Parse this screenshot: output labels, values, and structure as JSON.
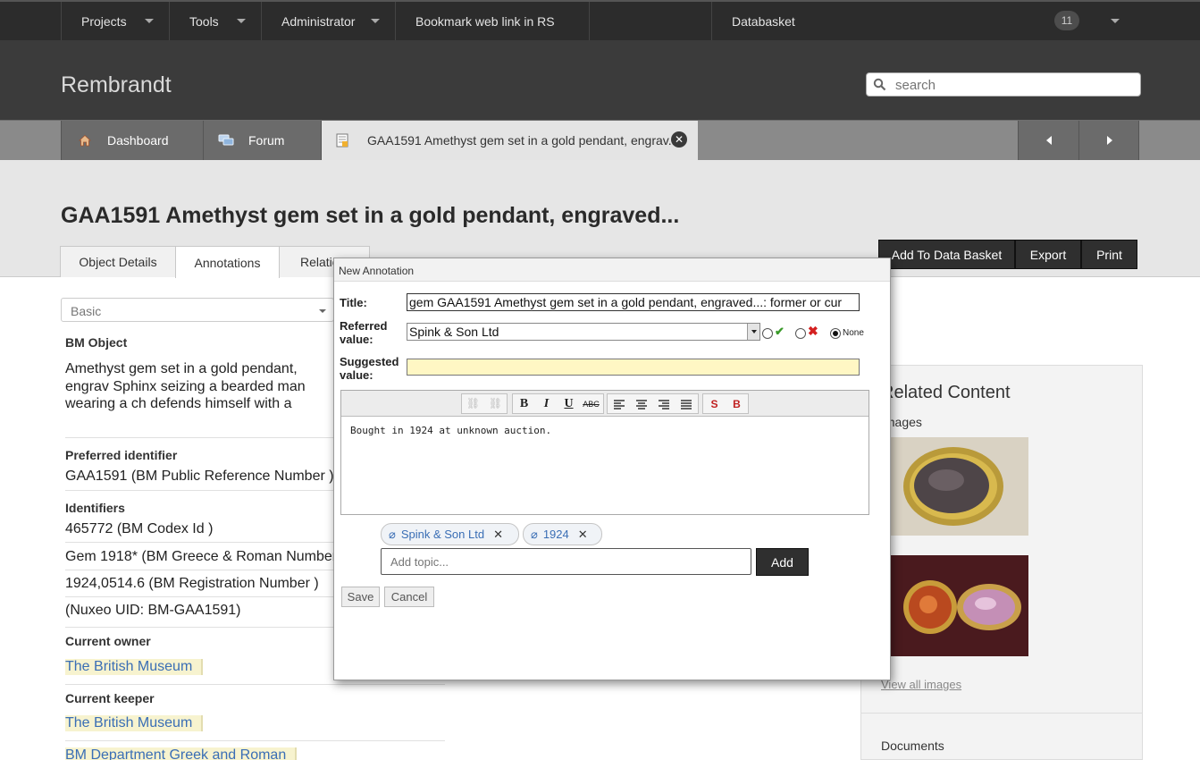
{
  "topnav": {
    "projects": "Projects",
    "tools": "Tools",
    "administrator": "Administrator",
    "bookmark": "Bookmark web link in RS",
    "databasket": "Databasket",
    "badge": "11"
  },
  "header": {
    "site_title": "Rembrandt",
    "search_placeholder": "search"
  },
  "tabs": {
    "dashboard": "Dashboard",
    "forum": "Forum",
    "record": "GAA1591 Amethyst gem set in a gold pendant, engrav..."
  },
  "page": {
    "title": "GAA1591 Amethyst gem set in a gold pendant, engraved...",
    "object_tabs": [
      "Object Details",
      "Annotations",
      "Relatio"
    ],
    "actions": [
      "Add To Data Basket",
      "Export",
      "Print"
    ]
  },
  "object": {
    "view_select": "Basic",
    "bm_object_label": "BM Object",
    "description": "Amethyst gem set in a gold pendant, engrav Sphinx seizing a bearded man wearing a ch defends himself with a sword.",
    "preferred_identifier_label": "Preferred identifier",
    "preferred_identifier": "GAA1591 (BM Public Reference Number )",
    "identifiers_label": "Identifiers",
    "identifiers": [
      "465772 (BM Codex Id )",
      "Gem 1918* (BM Greece & Roman Number",
      "1924,0514.6 (BM Registration Number )",
      "(Nuxeo UID: BM-GAA1591)"
    ],
    "current_owner_label": "Current owner",
    "current_owner": "The British Museum",
    "current_keeper_label": "Current keeper",
    "current_keeper": "The British Museum",
    "department": "BM Department Greek and Roman"
  },
  "sidebar": {
    "related_content": "Related Content",
    "images_label": "Images",
    "view_all_images": "View all images",
    "documents_label": "Documents"
  },
  "dialog": {
    "title": "New Annotation",
    "title_label": "Title:",
    "title_value": "gem GAA1591 Amethyst gem set in a gold pendant, engraved...: former or cur",
    "referred_label": "Referred value:",
    "referred_value": "Spink & Son Ltd",
    "radio_none_label": "None",
    "suggested_label": "Suggested value:",
    "suggested_value": "",
    "editor_text": "Bought in 1924 at unknown auction.",
    "tags": [
      "Spink & Son Ltd",
      "1924"
    ],
    "add_topic_placeholder": "Add topic...",
    "add_button": "Add",
    "save_button": "Save",
    "cancel_button": "Cancel"
  },
  "colors": {
    "topbar": "#2c2c2c",
    "header": "#3b3b3b",
    "link": "#3a6eb5",
    "highlight": "#f7f3cf",
    "suggested_field": "#fff7c4"
  }
}
